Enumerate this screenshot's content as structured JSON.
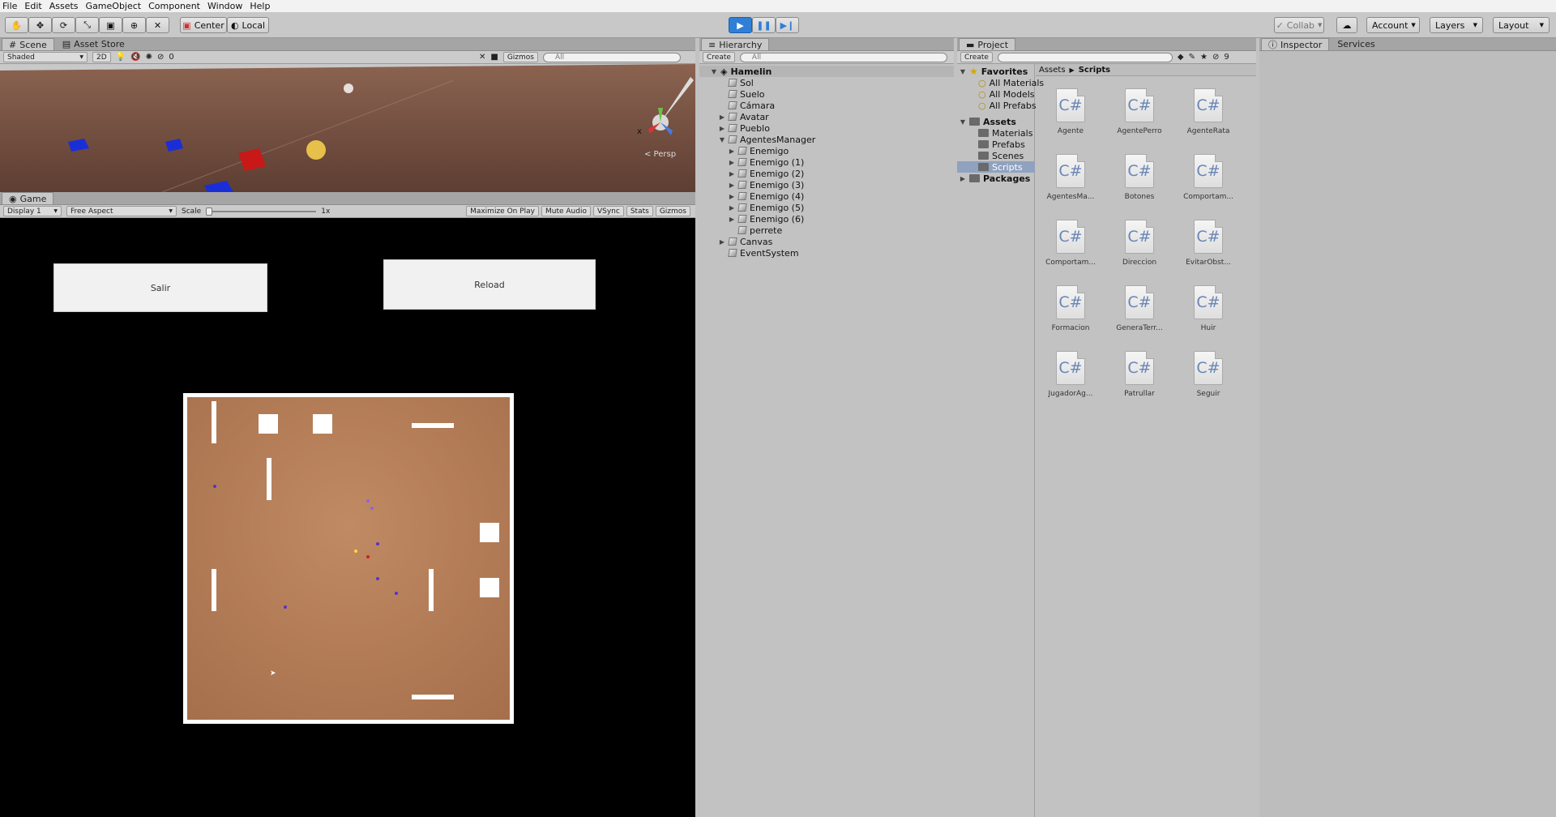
{
  "menu": [
    "File",
    "Edit",
    "Assets",
    "GameObject",
    "Component",
    "Window",
    "Help"
  ],
  "toolbar": {
    "pivot_label": "Center",
    "space_label": "Local",
    "collab_label": "Collab",
    "account_label": "Account",
    "layers_label": "Layers",
    "layout_label": "Layout"
  },
  "scene": {
    "tab_label": "Scene",
    "asset_store_label": "Asset Store",
    "shading_label": "Shaded",
    "mode_2d_label": "2D",
    "fx_count_label": "0",
    "gizmos_label": "Gizmos",
    "search_label": "All",
    "persp_label": "< Persp",
    "gizmo_x_label": "x"
  },
  "game": {
    "tab_label": "Game",
    "display_label": "Display 1",
    "aspect_label": "Free Aspect",
    "scale_label": "Scale",
    "scale_value": "1x",
    "maximize_label": "Maximize On Play",
    "mute_label": "Mute Audio",
    "vsync_label": "VSync",
    "stats_label": "Stats",
    "gizmos_label": "Gizmos",
    "salir_label": "Salir",
    "reload_label": "Reload"
  },
  "hierarchy": {
    "tab_label": "Hierarchy",
    "create_label": "Create",
    "search_label": "All",
    "scene_name": "Hamelin",
    "items": [
      {
        "label": "Sol",
        "depth": 1,
        "arrow": ""
      },
      {
        "label": "Suelo",
        "depth": 1,
        "arrow": ""
      },
      {
        "label": "Cámara",
        "depth": 1,
        "arrow": ""
      },
      {
        "label": "Avatar",
        "depth": 1,
        "arrow": "▶"
      },
      {
        "label": "Pueblo",
        "depth": 1,
        "arrow": "▶"
      },
      {
        "label": "AgentesManager",
        "depth": 1,
        "arrow": "▼"
      },
      {
        "label": "Enemigo",
        "depth": 2,
        "arrow": "▶"
      },
      {
        "label": "Enemigo (1)",
        "depth": 2,
        "arrow": "▶"
      },
      {
        "label": "Enemigo (2)",
        "depth": 2,
        "arrow": "▶"
      },
      {
        "label": "Enemigo (3)",
        "depth": 2,
        "arrow": "▶"
      },
      {
        "label": "Enemigo (4)",
        "depth": 2,
        "arrow": "▶"
      },
      {
        "label": "Enemigo (5)",
        "depth": 2,
        "arrow": "▶"
      },
      {
        "label": "Enemigo (6)",
        "depth": 2,
        "arrow": "▶"
      },
      {
        "label": "perrete",
        "depth": 2,
        "arrow": ""
      },
      {
        "label": "Canvas",
        "depth": 1,
        "arrow": "▶"
      },
      {
        "label": "EventSystem",
        "depth": 1,
        "arrow": ""
      }
    ]
  },
  "project": {
    "tab_label": "Project",
    "create_label": "Create",
    "badge_label": "9",
    "favorites_label": "Favorites",
    "favorites": [
      "All Materials",
      "All Models",
      "All Prefabs"
    ],
    "assets_label": "Assets",
    "asset_folders": [
      "Materials",
      "Prefabs",
      "Scenes",
      "Scripts"
    ],
    "packages_label": "Packages",
    "breadcrumb_root": "Assets",
    "breadcrumb_current": "Scripts",
    "csharp_glyph": "C#",
    "files": [
      "Agente",
      "AgentePerro",
      "AgenteRata",
      "AgentesMa...",
      "Botones",
      "Comportam...",
      "Comportam...",
      "Direccion",
      "EvitarObst...",
      "Formacion",
      "GeneraTerr...",
      "Huir",
      "JugadorAg...",
      "Patrullar",
      "Seguir"
    ]
  },
  "inspector": {
    "tab_label": "Inspector",
    "services_label": "Services"
  },
  "colors": {
    "ground": "#b47c5a",
    "scene_ground": "#6e4a3c",
    "play_blue": "#2f7fd6",
    "agent_purple": "#5533cc",
    "agent_red": "#cc2222",
    "player_yellow": "#ffd84a"
  }
}
